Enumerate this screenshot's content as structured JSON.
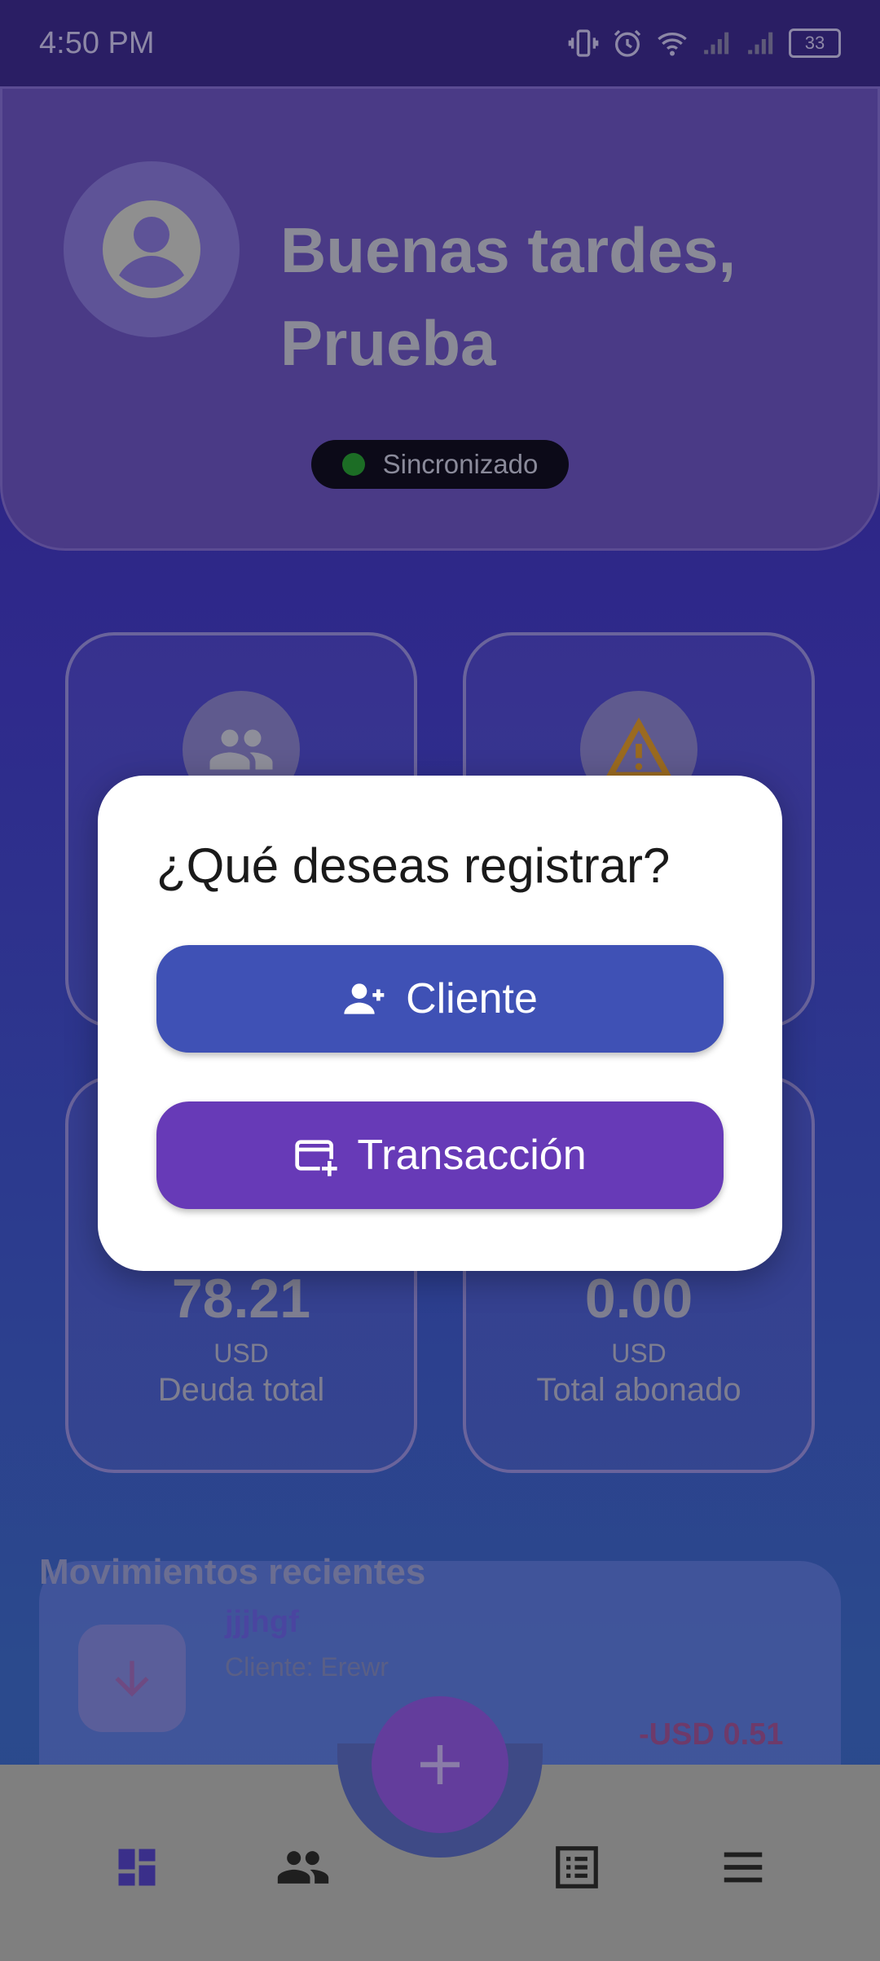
{
  "status_bar": {
    "time": "4:50 PM",
    "battery": "33"
  },
  "header": {
    "greeting_line1": "Buenas tardes,",
    "greeting_line2": "Prueba",
    "sync_status": "Sincronizado"
  },
  "stats": {
    "debt": {
      "value": "78.21",
      "unit": "USD",
      "label": "Deuda total"
    },
    "paid": {
      "value": "0.00",
      "unit": "USD",
      "label": "Total abonado"
    }
  },
  "recent": {
    "title": "Movimientos recientes",
    "items": [
      {
        "name": "jjjhgf",
        "client": "Cliente: Erewr",
        "amount": "-USD 0.51"
      }
    ]
  },
  "dialog": {
    "title": "¿Qué deseas registrar?",
    "client_button": "Cliente",
    "transaction_button": "Transacción"
  },
  "colors": {
    "client_button": "#3f51b5",
    "transaction_button": "#673ab7",
    "fab": "#673ab7"
  }
}
